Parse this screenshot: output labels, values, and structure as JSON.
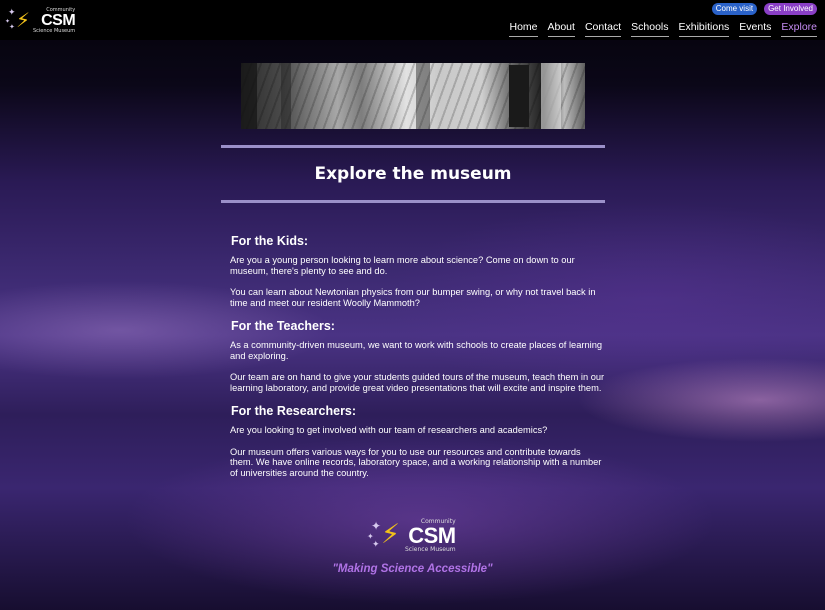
{
  "header": {
    "logo": {
      "community": "Community",
      "title": "CSM",
      "subtitle": "Science Museum",
      "icon": "bolt-stars-icon"
    },
    "actions": [
      {
        "label": "Come visit",
        "color": "#2a62c9"
      },
      {
        "label": "Get Involved",
        "color": "#8a3fc6"
      }
    ],
    "nav": [
      {
        "label": "Home"
      },
      {
        "label": "About"
      },
      {
        "label": "Contact"
      },
      {
        "label": "Schools"
      },
      {
        "label": "Exhibitions"
      },
      {
        "label": "Events"
      },
      {
        "label": "Explore",
        "active": true
      }
    ]
  },
  "main": {
    "title": "Explore the museum",
    "sections": [
      {
        "heading": "For the Kids:",
        "paragraphs": [
          "Are you a young person looking to learn more about science? Come on down to our museum, there's plenty to see and do.",
          "You can learn about Newtonian physics from our bumper swing, or why not travel back in time and meet our resident Woolly Mammoth?"
        ]
      },
      {
        "heading": "For the Teachers:",
        "paragraphs": [
          "As a community-driven museum, we want to work with schools to create places of learning and exploring.",
          "Our team are on hand to give your students guided tours of the museum, teach them in our learning laboratory, and provide great video presentations that will excite and inspire them."
        ]
      },
      {
        "heading": "For the Researchers:",
        "paragraphs": [
          "Are you looking to get involved with our team of researchers and academics?",
          "Our museum offers various ways for you to use our resources and contribute towards them. We have online records, laboratory space, and a working relationship with a number of universities around the country."
        ]
      }
    ]
  },
  "footer": {
    "logo": {
      "community": "Community",
      "title": "CSM",
      "subtitle": "Science Museum"
    },
    "tagline": "\"Making Science Accessible\""
  },
  "colors": {
    "accent_purple": "#c58cf2",
    "tagline_purple": "#b073e6",
    "divider": "#9b90c9",
    "bolt_yellow": "#f2c21a"
  }
}
